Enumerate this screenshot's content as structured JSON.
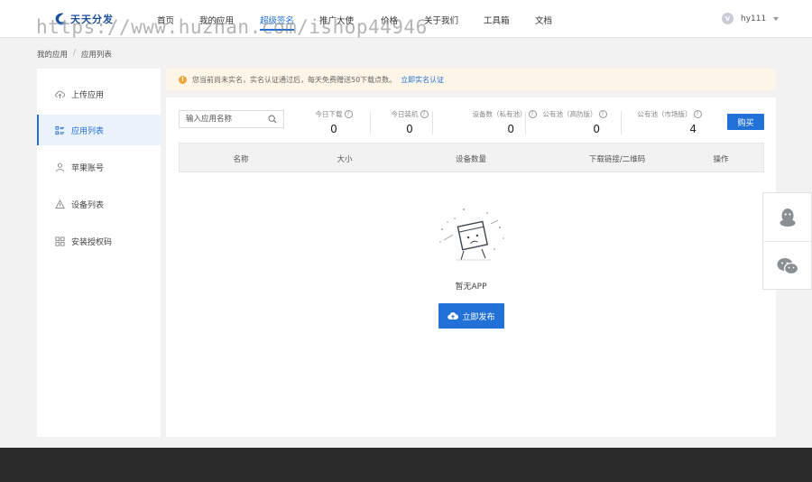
{
  "brand": {
    "name": "天天分发",
    "accent": "#2271d6"
  },
  "nav": {
    "items": [
      {
        "label": "首页"
      },
      {
        "label": "我的应用"
      },
      {
        "label": "超级签名",
        "active": true
      },
      {
        "label": "推广大使"
      },
      {
        "label": "价格"
      },
      {
        "label": "关于我们"
      },
      {
        "label": "工具箱"
      },
      {
        "label": "文档"
      }
    ]
  },
  "user": {
    "badge": "V",
    "name": "hy111"
  },
  "watermark": "https://www.huzhan.com/ishop44946",
  "breadcrumb": {
    "parent": "我的应用",
    "separator": "/",
    "current": "应用列表"
  },
  "sidebar": {
    "items": [
      {
        "label": "上传应用",
        "icon": "cloud-upload-icon"
      },
      {
        "label": "应用列表",
        "icon": "list-icon",
        "active": true
      },
      {
        "label": "苹果账号",
        "icon": "user-icon"
      },
      {
        "label": "设备列表",
        "icon": "device-icon"
      },
      {
        "label": "安装授权码",
        "icon": "grid-icon"
      }
    ]
  },
  "notice": {
    "text": "您当前尚未实名，实名认证通过后，每天免费赠送50下载点数。",
    "link": "立即实名认证",
    "color": "#f0a43a"
  },
  "search": {
    "placeholder": "输入应用名称",
    "value": ""
  },
  "stats": [
    {
      "label": "今日下载",
      "value": "0"
    },
    {
      "label": "今日装机",
      "value": "0"
    },
    {
      "label": "设备数（私有池）",
      "value": "0"
    },
    {
      "label": "公有池（高防版）",
      "value": "0"
    },
    {
      "label": "公有池（市场版）",
      "value": "4"
    }
  ],
  "buy_button": "购买",
  "table": {
    "columns": [
      "名称",
      "大小",
      "设备数量",
      "下载链接/二维码",
      "操作"
    ]
  },
  "empty": {
    "text": "暂无APP",
    "button": "立即发布"
  }
}
